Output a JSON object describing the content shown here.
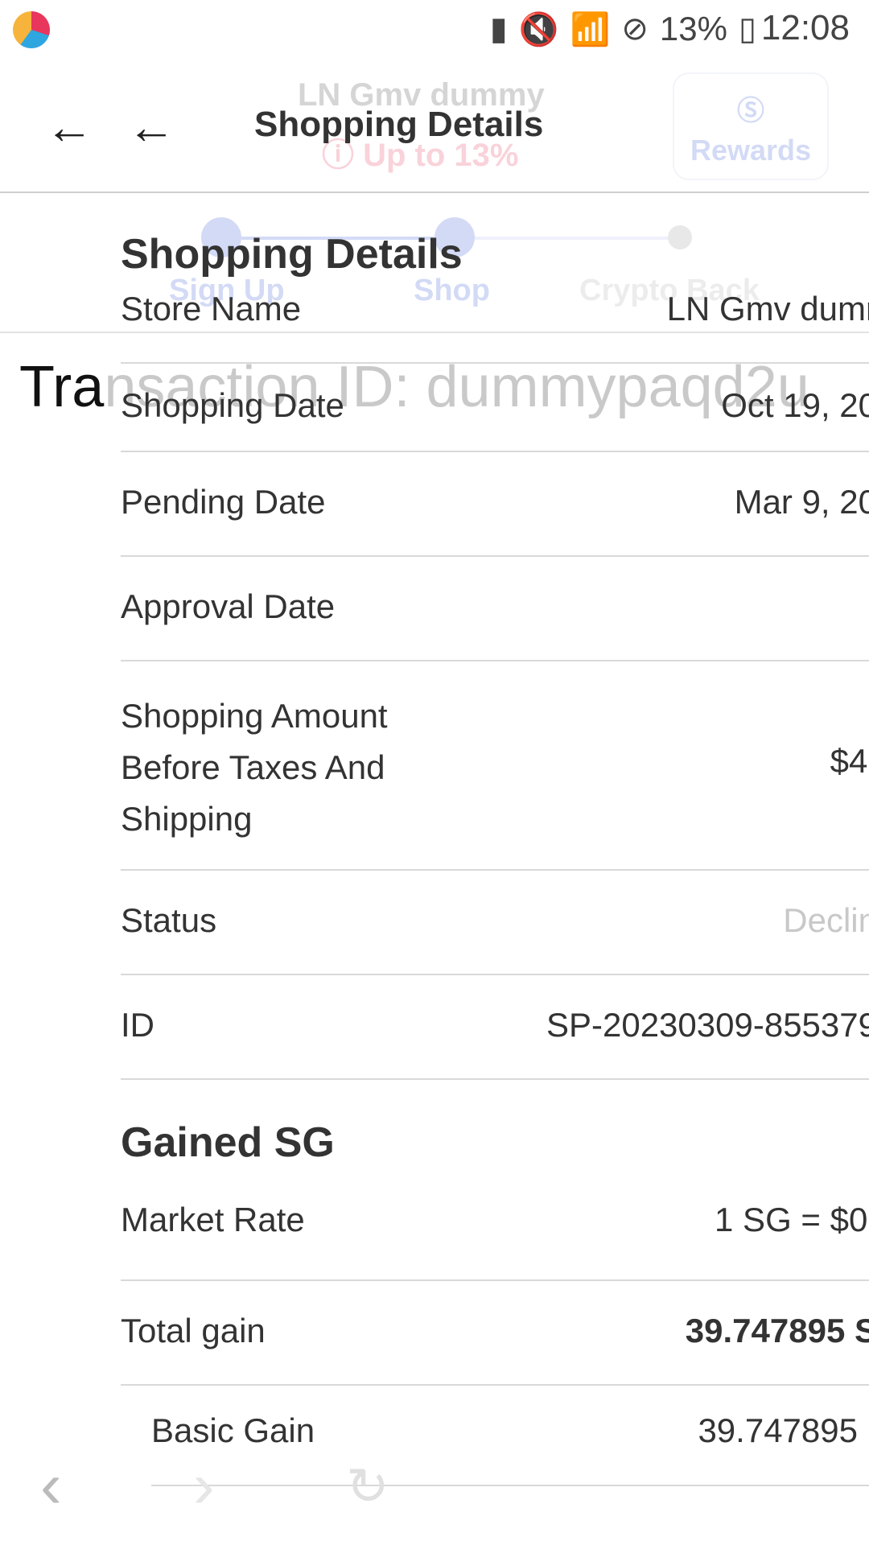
{
  "status_bar": {
    "battery": "13%",
    "time": "12:08"
  },
  "background": {
    "store_name": "LN Gmv dummy",
    "cashback": "Up to 13%",
    "rewards_label": "Rewards",
    "steps": [
      "Sign Up",
      "Shop",
      "Crypto Back"
    ]
  },
  "header": {
    "title": "Shopping Details"
  },
  "transaction_prefix": "Tra",
  "transaction_rest": "nsaction ID: dummypaqd2u",
  "sheet": {
    "title": "Shopping Details",
    "rows": [
      {
        "label": "Store Name",
        "value": "LN Gmv dumr"
      },
      {
        "label": "Shopping Date",
        "value": "Oct 19, 20"
      },
      {
        "label": "Pending Date",
        "value": "Mar 9, 20"
      },
      {
        "label": "Approval Date",
        "value": ""
      },
      {
        "label": "Shopping Amount Before Taxes And Shipping",
        "value": "$4."
      },
      {
        "label": "Status",
        "value": "Declin"
      },
      {
        "label": "ID",
        "value": "SP-20230309-855379"
      }
    ],
    "gained_title": "Gained SG",
    "gain_rows": [
      {
        "label": "Market Rate",
        "value": "1 SG = $0."
      },
      {
        "label": "Total gain",
        "value": "39.747895 S"
      },
      {
        "label": "Basic Gain",
        "value": "39.747895"
      }
    ]
  },
  "colors": {
    "brand": "#3b5bd6",
    "accent": "#e8365d",
    "status_declined": "#c8c8c8"
  }
}
